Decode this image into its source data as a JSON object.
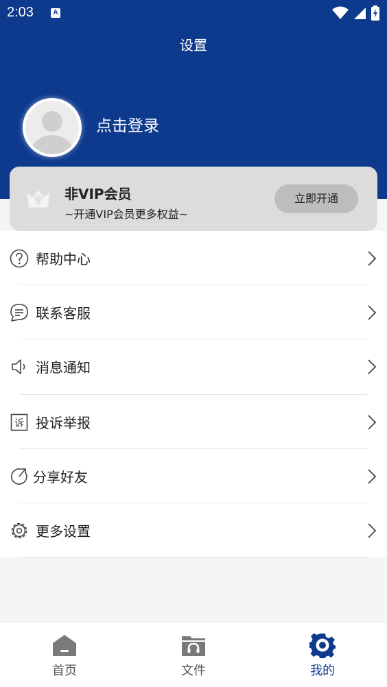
{
  "status_bar": {
    "time": "2:03",
    "notification_badge": "A"
  },
  "header": {
    "title": "设置",
    "login_text": "点击登录"
  },
  "vip": {
    "title": "非VIP会员",
    "subtitle": "~开通VIP会员更多权益~",
    "button_label": "立即开通"
  },
  "menu": {
    "items": [
      {
        "label": "帮助中心",
        "icon": "help-circle-icon"
      },
      {
        "label": "联系客服",
        "icon": "chat-bubble-icon"
      },
      {
        "label": "消息通知",
        "icon": "speaker-icon"
      },
      {
        "label": "投诉举报",
        "icon": "complaint-icon"
      },
      {
        "label": "分享好友",
        "icon": "share-icon"
      },
      {
        "label": "更多设置",
        "icon": "gear-icon"
      }
    ]
  },
  "tabs": [
    {
      "label": "首页",
      "icon": "home-icon",
      "active": false
    },
    {
      "label": "文件",
      "icon": "folder-headphones-icon",
      "active": false
    },
    {
      "label": "我的",
      "icon": "gear-settings-icon",
      "active": true
    }
  ],
  "colors": {
    "primary": "#0e3a8e",
    "card": "#dcdcdc",
    "button": "#bdbdbd"
  }
}
